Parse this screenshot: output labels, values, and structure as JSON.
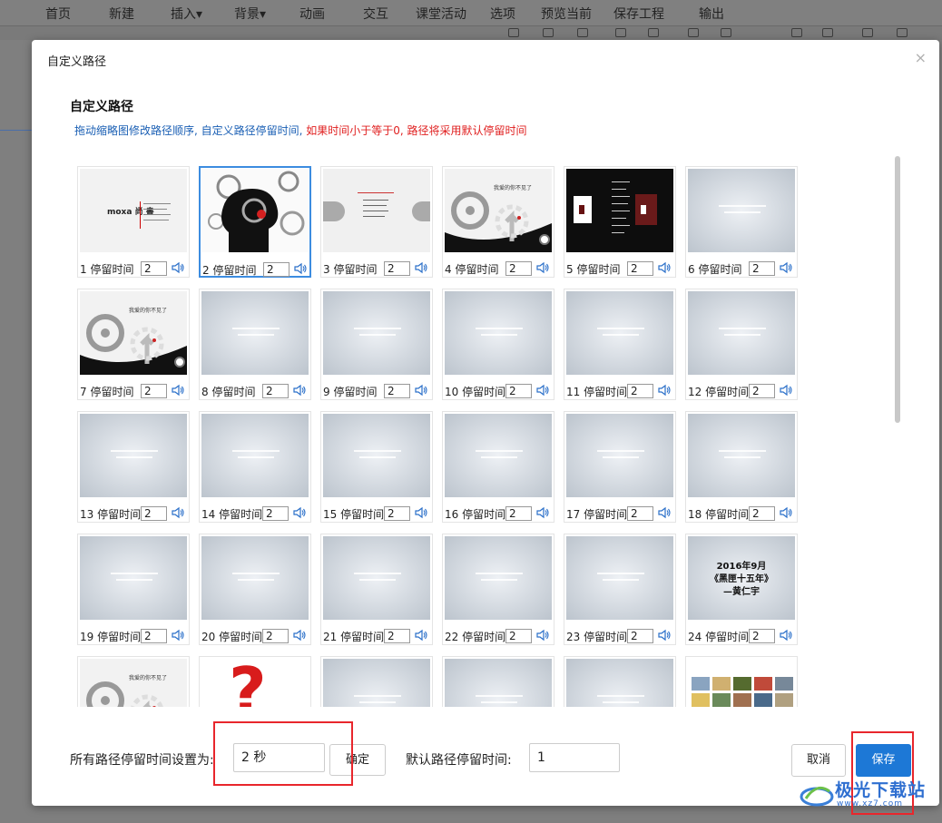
{
  "app_menu": [
    "首页",
    "新建",
    "插入▾",
    "背景▾",
    "动画",
    "交互",
    "课堂活动",
    "选项",
    "预览当前",
    "保存工程",
    "输出"
  ],
  "dialog": {
    "title": "自定义路径",
    "close": "×",
    "section_title": "自定义路径",
    "hint_blue": "拖动缩略图修改路径顺序, 自定义路径停留时间, ",
    "hint_red": "如果时间小于等于0, 路径将采用默认停留时间"
  },
  "slides": [
    {
      "label": "1  停留时间",
      "value": "2",
      "thumb": "title-white",
      "text": "moxa 尚 書"
    },
    {
      "label": "2  停留时间",
      "value": "2",
      "thumb": "gears-head",
      "text": ""
    },
    {
      "label": "3  停留时间",
      "value": "2",
      "thumb": "pills",
      "text": ""
    },
    {
      "label": "4  停留时间",
      "value": "2",
      "thumb": "wheel",
      "text": "我爱的你不见了"
    },
    {
      "label": "5  停留时间",
      "value": "2",
      "thumb": "black",
      "text": ""
    },
    {
      "label": "6  停留时间",
      "value": "2",
      "thumb": "plain",
      "text": ""
    },
    {
      "label": "7  停留时间",
      "value": "2",
      "thumb": "wheel",
      "text": "我爱的你不见了"
    },
    {
      "label": "8  停留时间",
      "value": "2",
      "thumb": "plain",
      "text": ""
    },
    {
      "label": "9  停留时间",
      "value": "2",
      "thumb": "plain",
      "text": ""
    },
    {
      "label": "10 停留时间",
      "value": "2",
      "thumb": "plain",
      "text": ""
    },
    {
      "label": "11 停留时间",
      "value": "2",
      "thumb": "plain",
      "text": ""
    },
    {
      "label": "12 停留时间",
      "value": "2",
      "thumb": "plain",
      "text": ""
    },
    {
      "label": "13 停留时间",
      "value": "2",
      "thumb": "plain",
      "text": ""
    },
    {
      "label": "14 停留时间",
      "value": "2",
      "thumb": "plain",
      "text": ""
    },
    {
      "label": "15 停留时间",
      "value": "2",
      "thumb": "plain",
      "text": ""
    },
    {
      "label": "16 停留时间",
      "value": "2",
      "thumb": "plain",
      "text": ""
    },
    {
      "label": "17 停留时间",
      "value": "2",
      "thumb": "plain",
      "text": ""
    },
    {
      "label": "18 停留时间",
      "value": "2",
      "thumb": "plain",
      "text": ""
    },
    {
      "label": "19 停留时间",
      "value": "2",
      "thumb": "plain",
      "text": ""
    },
    {
      "label": "20 停留时间",
      "value": "2",
      "thumb": "plain",
      "text": ""
    },
    {
      "label": "21 停留时间",
      "value": "2",
      "thumb": "plain",
      "text": ""
    },
    {
      "label": "22 停留时间",
      "value": "2",
      "thumb": "plain",
      "text": ""
    },
    {
      "label": "23 停留时间",
      "value": "2",
      "thumb": "plain",
      "text": ""
    },
    {
      "label": "24 停留时间",
      "value": "2",
      "thumb": "date",
      "text": "2016年9月"
    },
    {
      "label": "",
      "value": "",
      "thumb": "wheel",
      "text": "我爱的你不见了"
    },
    {
      "label": "",
      "value": "",
      "thumb": "question",
      "text": "?"
    },
    {
      "label": "",
      "value": "",
      "thumb": "plain",
      "text": ""
    },
    {
      "label": "",
      "value": "",
      "thumb": "plain",
      "text": ""
    },
    {
      "label": "",
      "value": "",
      "thumb": "plain",
      "text": ""
    },
    {
      "label": "",
      "value": "",
      "thumb": "photos",
      "text": ""
    }
  ],
  "slide24": {
    "line1": "2016年9月",
    "line2": "《黑匣十五年》",
    "line3": "—黄仁宇"
  },
  "footer": {
    "all_label": "所有路径停留时间设置为:",
    "all_value": "2 秒",
    "ok": "确定",
    "default_label": "默认路径停留时间:",
    "default_value": "1",
    "cancel": "取消",
    "save": "保存"
  },
  "watermark": {
    "title": "极光下载站",
    "sub": "www.xz7.com"
  },
  "colors": {
    "accent": "#1d78d6",
    "highlight": "#e8262c",
    "hint_blue": "#1a5fb4",
    "hint_red": "#e02020"
  }
}
